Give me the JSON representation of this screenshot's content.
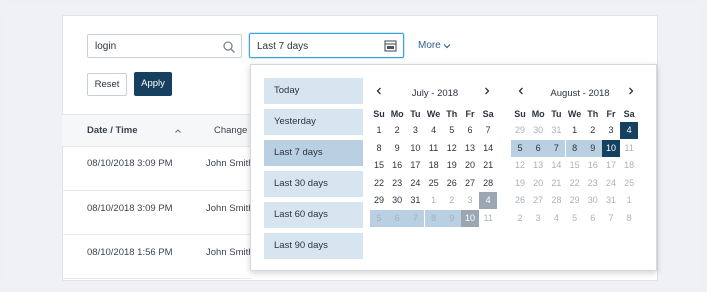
{
  "filters": {
    "search_value": "login",
    "date_value": "Last 7 days",
    "more_label": "More",
    "reset_label": "Reset",
    "apply_label": "Apply"
  },
  "table": {
    "columns": [
      "Date / Time",
      "Change"
    ],
    "rows": [
      {
        "datetime": "08/10/2018 3:09 PM",
        "user": "John Smith"
      },
      {
        "datetime": "08/10/2018 3:09 PM",
        "user": "John Smith"
      },
      {
        "datetime": "08/10/2018 1:56 PM",
        "user": "John Smith"
      }
    ]
  },
  "datepicker": {
    "presets": [
      "Today",
      "Yesterday",
      "Last 7 days",
      "Last 30 days",
      "Last 60 days",
      "Last 90 days"
    ],
    "active_preset": "Last 7 days",
    "weekdays": [
      "Su",
      "Mo",
      "Tu",
      "We",
      "Th",
      "Fr",
      "Sa"
    ],
    "months": [
      {
        "title": "July - 2018",
        "weeks": [
          [
            "1",
            "2",
            "3",
            "4",
            "5",
            "6",
            "7"
          ],
          [
            "8",
            "9",
            "10",
            "11",
            "12",
            "13",
            "14"
          ],
          [
            "15",
            "16",
            "17",
            "18",
            "19",
            "20",
            "21"
          ],
          [
            "22",
            "23",
            "24",
            "25",
            "26",
            "27",
            "28"
          ],
          [
            "29",
            "30",
            "31",
            "1",
            "2",
            "3",
            "4"
          ],
          [
            "5",
            "6",
            "7",
            "8",
            "9",
            "10",
            "11"
          ]
        ],
        "muted_from_week": 4,
        "muted_from_col": 3,
        "range_cells": [
          [
            5,
            0
          ],
          [
            5,
            1
          ],
          [
            5,
            2
          ],
          [
            5,
            3
          ],
          [
            5,
            4
          ]
        ],
        "end_gray": [
          [
            4,
            6
          ],
          [
            5,
            5
          ]
        ]
      },
      {
        "title": "August - 2018",
        "weeks": [
          [
            "29",
            "30",
            "31",
            "1",
            "2",
            "3",
            "4"
          ],
          [
            "5",
            "6",
            "7",
            "8",
            "9",
            "10",
            "11"
          ],
          [
            "12",
            "13",
            "14",
            "15",
            "16",
            "17",
            "18"
          ],
          [
            "19",
            "20",
            "21",
            "22",
            "23",
            "24",
            "25"
          ],
          [
            "26",
            "27",
            "28",
            "29",
            "30",
            "31",
            "1"
          ],
          [
            "2",
            "3",
            "4",
            "5",
            "6",
            "7",
            "8"
          ]
        ],
        "range_cells": [
          [
            1,
            0
          ],
          [
            1,
            1
          ],
          [
            1,
            2
          ],
          [
            1,
            3
          ],
          [
            1,
            4
          ]
        ],
        "end_dark": [
          [
            0,
            6
          ],
          [
            1,
            5
          ]
        ]
      }
    ]
  }
}
